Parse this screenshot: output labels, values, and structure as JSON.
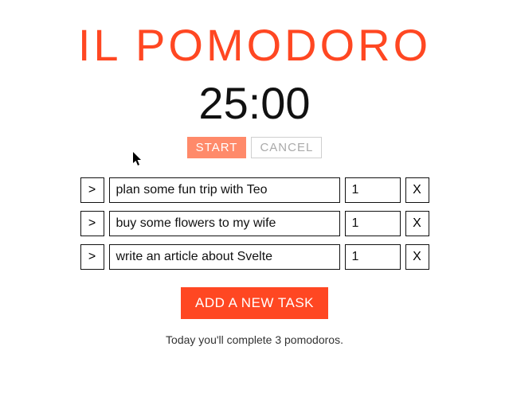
{
  "app": {
    "title": "IL POMODORO",
    "timer_value": "25:00",
    "start_label": "START",
    "cancel_label": "CANCEL",
    "add_task_label": "ADD A NEW TASK",
    "summary_text": "Today you'll complete 3 pomodoros."
  },
  "tasks": [
    {
      "expand_icon": ">",
      "title": "plan some fun trip with Teo",
      "pomodoros": "1",
      "remove_icon": "X"
    },
    {
      "expand_icon": ">",
      "title": "buy some flowers to my wife",
      "pomodoros": "1",
      "remove_icon": "X"
    },
    {
      "expand_icon": ">",
      "title": "write an article about Svelte",
      "pomodoros": "1",
      "remove_icon": "X"
    }
  ]
}
